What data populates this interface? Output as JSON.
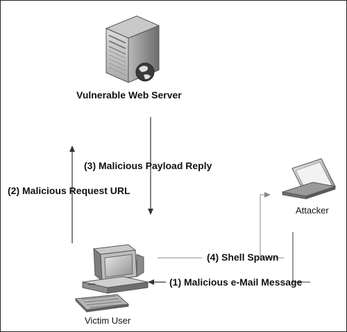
{
  "nodes": {
    "server": {
      "label": "Vulnerable Web Server",
      "icon": "server-icon"
    },
    "attacker": {
      "label": "Attacker",
      "icon": "laptop-icon"
    },
    "victim": {
      "label": "Victim User",
      "icon": "desktop-computer-icon"
    }
  },
  "flows": [
    {
      "step": "(1)",
      "label": "(1) Malicious e-Mail Message",
      "from": "attacker",
      "to": "victim"
    },
    {
      "step": "(2)",
      "label": "(2) Malicious Request URL",
      "from": "victim",
      "to": "server"
    },
    {
      "step": "(3)",
      "label": "(3) Malicious Payload Reply",
      "from": "server",
      "to": "victim"
    },
    {
      "step": "(4)",
      "label": "(4) Shell Spawn",
      "from": "victim",
      "to": "attacker"
    }
  ],
  "colors": {
    "border": "#222222",
    "arrow_dark": "#333333",
    "arrow_light": "#888888",
    "icon_gray": "#8a8a8a"
  }
}
